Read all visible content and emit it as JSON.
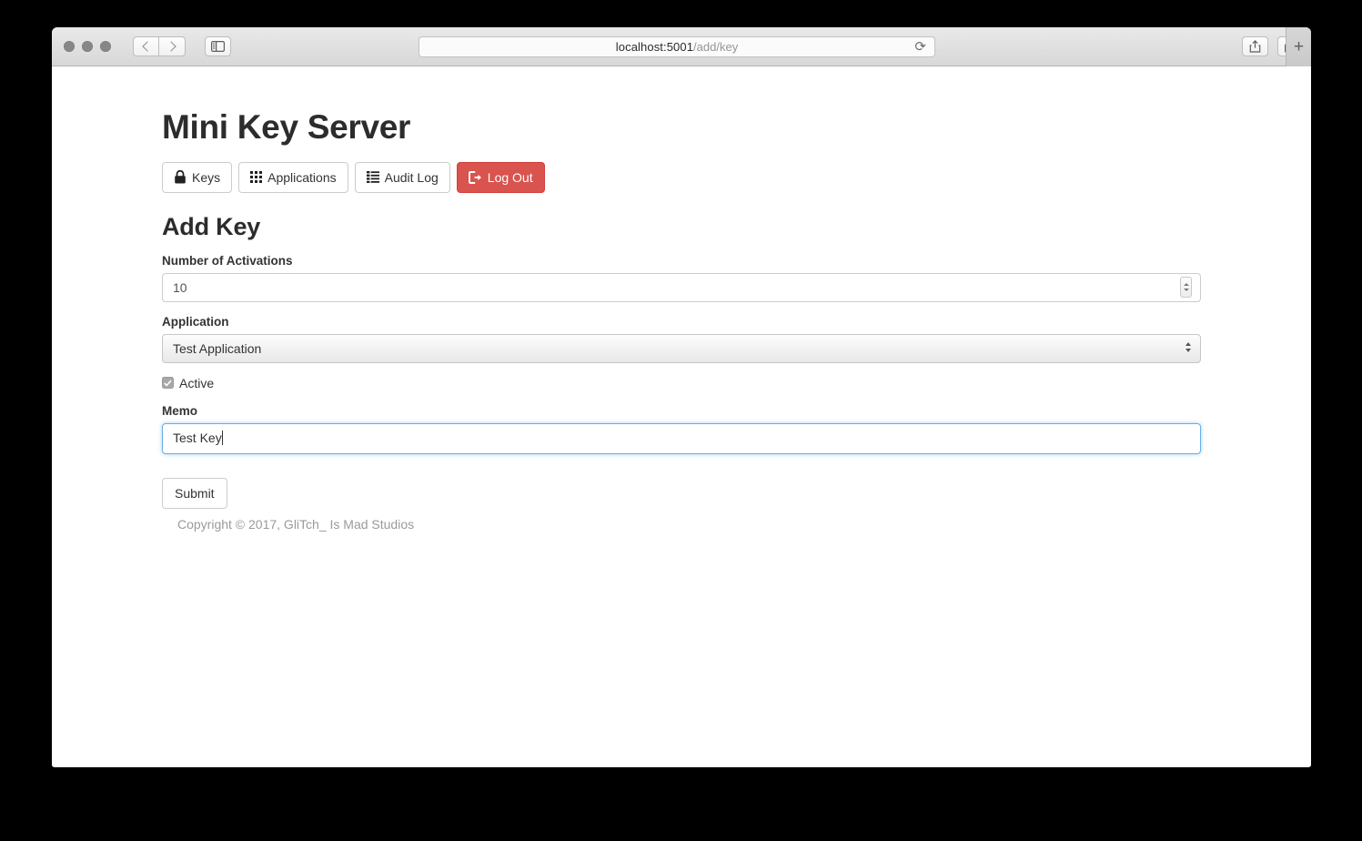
{
  "browser": {
    "url_host": "localhost:5001",
    "url_path": "/add/key",
    "reload_icon": "reload-icon",
    "back_icon": "back-chevron-icon",
    "forward_icon": "forward-chevron-icon",
    "sidebar_icon": "sidebar-toggle-icon",
    "share_icon": "share-icon",
    "tabs_icon": "show-tabs-icon",
    "new_tab_label": "+"
  },
  "site": {
    "title": "Mini Key Server",
    "nav": [
      {
        "label": "Keys",
        "icon": "lock-icon",
        "style": "default"
      },
      {
        "label": "Applications",
        "icon": "grid-icon",
        "style": "default"
      },
      {
        "label": "Audit Log",
        "icon": "list-icon",
        "style": "default"
      },
      {
        "label": "Log Out",
        "icon": "sign-out-icon",
        "style": "danger"
      }
    ]
  },
  "form": {
    "heading": "Add Key",
    "activations": {
      "label": "Number of Activations",
      "value": "10"
    },
    "application": {
      "label": "Application",
      "selected": "Test Application",
      "options": [
        "Test Application"
      ]
    },
    "active": {
      "label": "Active",
      "checked": true
    },
    "memo": {
      "label": "Memo",
      "value": "Test Key",
      "focused": true
    },
    "submit_label": "Submit"
  },
  "footer": {
    "copyright": "Copyright © 2017, GliTch_ Is Mad Studios"
  },
  "colors": {
    "danger": "#d9534f",
    "focus_blue": "#66afe9",
    "text": "#333333"
  }
}
